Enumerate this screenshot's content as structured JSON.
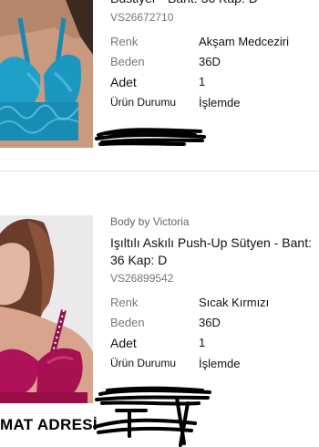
{
  "orders": [
    {
      "product_name": "Bustiyer - Bant: 36 Kap: D",
      "sku": "VS26672710",
      "details": [
        {
          "label": "Renk",
          "value": "Akşam Medceziri"
        },
        {
          "label": "Beden",
          "value": "36D"
        },
        {
          "label": "Adet",
          "value": "1"
        },
        {
          "label": "Ürün Durumu",
          "value": "İşlemde"
        }
      ]
    },
    {
      "brand": "Body by Victoria",
      "product_name": "Işıltılı Askılı Push-Up Sütyen - Bant: 36 Kap: D",
      "sku": "VS26899542",
      "details": [
        {
          "label": "Renk",
          "value": "Sıcak Kırmızı"
        },
        {
          "label": "Beden",
          "value": "36D"
        },
        {
          "label": "Adet",
          "value": "1"
        },
        {
          "label": "Ürün Durumu",
          "value": "İşlemde"
        }
      ]
    }
  ],
  "address_heading": "MAT ADRESİ",
  "colors": {
    "product1_fabric": "#1ea0c8",
    "product2_fabric": "#b0125a",
    "text_primary": "#111111",
    "text_secondary": "#777777",
    "divider": "#e2e2e2",
    "redaction": "#000000"
  }
}
